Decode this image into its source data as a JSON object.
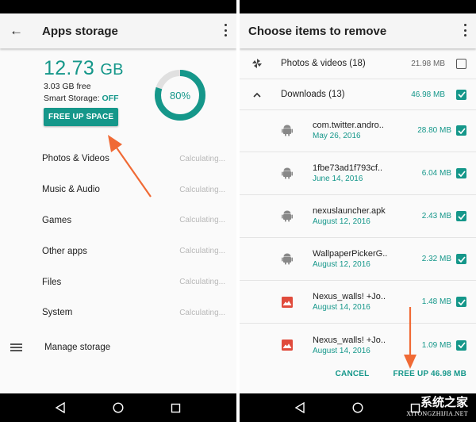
{
  "left": {
    "appbar": {
      "title": "Apps storage",
      "back_icon": "arrow-left",
      "more_icon": "more-vertical"
    },
    "summary": {
      "used_value": "12.73",
      "used_unit": "GB",
      "free_text": "3.03 GB free",
      "smart_storage_label": "Smart Storage: ",
      "smart_storage_value": "OFF",
      "free_up_button": "FREE UP SPACE"
    },
    "usage": {
      "percent": 80,
      "label": "80%"
    },
    "categories": [
      {
        "name": "Photos & Videos",
        "value": "Calculating..."
      },
      {
        "name": "Music & Audio",
        "value": "Calculating..."
      },
      {
        "name": "Games",
        "value": "Calculating..."
      },
      {
        "name": "Other apps",
        "value": "Calculating..."
      },
      {
        "name": "Files",
        "value": "Calculating..."
      },
      {
        "name": "System",
        "value": "Calculating..."
      }
    ],
    "manage": {
      "label": "Manage storage",
      "icon": "storage-list"
    }
  },
  "right": {
    "appbar": {
      "title": "Choose items to remove",
      "more_icon": "more-vertical"
    },
    "groups": [
      {
        "name": "Photos & videos (18)",
        "size": "21.98 MB",
        "checked": false,
        "icon": "pinwheel"
      },
      {
        "name": "Downloads (13)",
        "size": "46.98 MB",
        "checked": true,
        "icon": "chevron-up"
      }
    ],
    "files": [
      {
        "name": "com.twitter.andro..",
        "date": "May 26, 2016",
        "size": "28.80 MB",
        "checked": true,
        "icon": "android"
      },
      {
        "name": "1fbe73ad1f793cf..",
        "date": "June 14, 2016",
        "size": "6.04 MB",
        "checked": true,
        "icon": "android"
      },
      {
        "name": "nexuslauncher.apk",
        "date": "August 12, 2016",
        "size": "2.43 MB",
        "checked": true,
        "icon": "android"
      },
      {
        "name": "WallpaperPickerG..",
        "date": "August 12, 2016",
        "size": "2.32 MB",
        "checked": true,
        "icon": "android"
      },
      {
        "name": "Nexus_walls! +Jo..",
        "date": "August 14, 2016",
        "size": "1.48 MB",
        "checked": true,
        "icon": "image"
      },
      {
        "name": "Nexus_walls! +Jo..",
        "date": "August 14, 2016",
        "size": "1.09 MB",
        "checked": true,
        "icon": "image"
      }
    ],
    "actions": {
      "cancel": "CANCEL",
      "confirm": "FREE UP 46.98 MB"
    }
  },
  "colors": {
    "accent": "#15978a",
    "annotation_arrow": "#f06a35",
    "image_icon": "#e04b3c"
  },
  "watermark": {
    "main": "系统之家",
    "sub": "XITONGZHIJIA.NET"
  }
}
